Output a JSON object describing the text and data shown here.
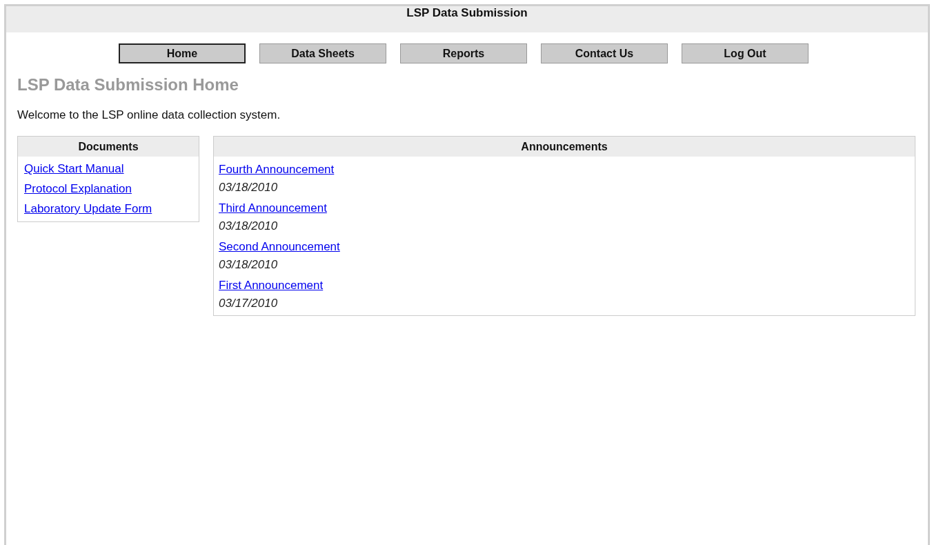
{
  "window": {
    "title": "LSP Data Submission"
  },
  "nav": [
    {
      "label": "Home",
      "selected": true
    },
    {
      "label": "Data Sheets",
      "selected": false
    },
    {
      "label": "Reports",
      "selected": false
    },
    {
      "label": "Contact Us",
      "selected": false
    },
    {
      "label": "Log Out",
      "selected": false
    }
  ],
  "heading": "LSP Data Submission Home",
  "welcome": "Welcome to the LSP online data collection system.",
  "documents": {
    "title": "Documents",
    "links": [
      "Quick Start Manual",
      "Protocol Explanation",
      "Laboratory Update Form"
    ]
  },
  "announcements": {
    "title": "Announcements",
    "items": [
      {
        "title": "Fourth Announcement",
        "date": "03/18/2010"
      },
      {
        "title": "Third Announcement",
        "date": "03/18/2010"
      },
      {
        "title": "Second Announcement",
        "date": "03/18/2010"
      },
      {
        "title": "First Announcement",
        "date": "03/17/2010"
      }
    ]
  }
}
